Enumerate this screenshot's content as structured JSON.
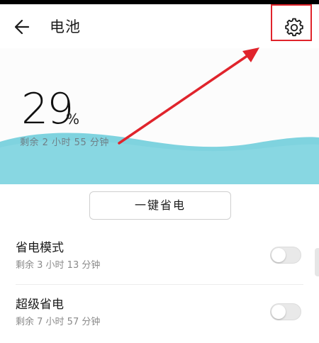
{
  "header": {
    "title": "电池",
    "back_icon": "back-arrow-icon",
    "settings_icon": "gear-icon"
  },
  "battery": {
    "percent": "29",
    "unit": "%",
    "remaining": "剩余 2 小时 55 分钟"
  },
  "actions": {
    "one_click_label": "一键省电"
  },
  "settings": [
    {
      "title": "省电模式",
      "subtitle": "剩余 3 小时 13 分钟",
      "enabled": false
    },
    {
      "title": "超级省电",
      "subtitle": "剩余 7 小时 57 分钟",
      "enabled": false
    }
  ],
  "colors": {
    "wave": "#7fd3df",
    "highlight": "#e0242c"
  }
}
